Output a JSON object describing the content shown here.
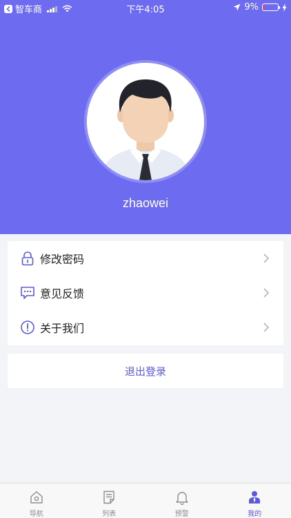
{
  "status_bar": {
    "carrier": "智车商",
    "time": "下午4:05",
    "battery": "9%"
  },
  "profile": {
    "username": "zhaowei"
  },
  "menu": [
    {
      "label": "修改密码",
      "icon": "lock-icon"
    },
    {
      "label": "意见反馈",
      "icon": "feedback-icon"
    },
    {
      "label": "关于我们",
      "icon": "info-icon"
    }
  ],
  "logout": {
    "label": "退出登录"
  },
  "tabbar": {
    "items": [
      {
        "label": "导航",
        "icon": "home-icon",
        "active": false
      },
      {
        "label": "列表",
        "icon": "list-icon",
        "active": false
      },
      {
        "label": "预警",
        "icon": "bell-icon",
        "active": false
      },
      {
        "label": "我的",
        "icon": "user-icon",
        "active": true
      }
    ]
  },
  "colors": {
    "header_bg": "#6d6cf0",
    "accent": "#5b5ad8",
    "page_bg": "#f3f4f8",
    "battery_low": "#ff3b5c"
  }
}
